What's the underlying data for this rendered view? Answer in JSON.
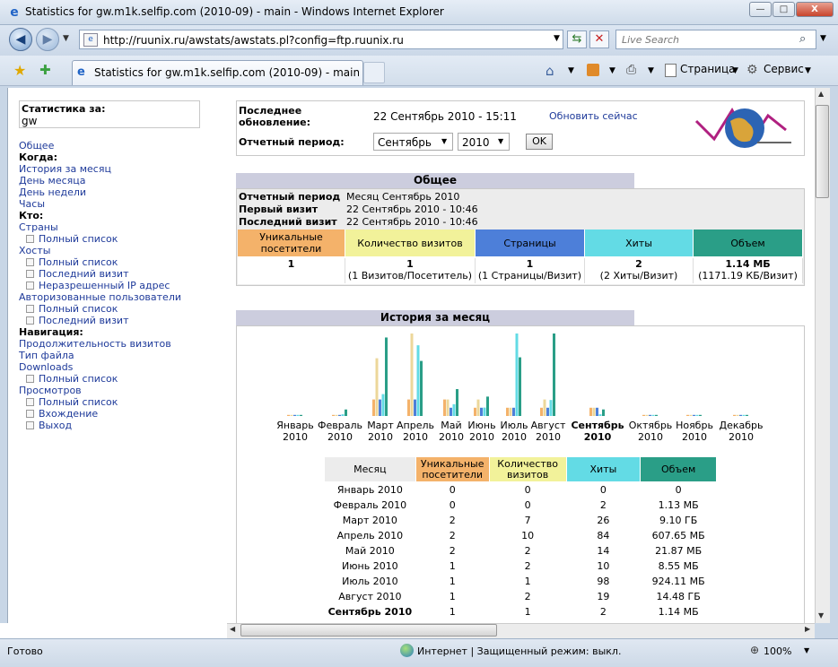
{
  "window": {
    "title": "Statistics for gw.m1k.selfip.com (2010-09) - main - Windows Internet Explorer",
    "minimize": "—",
    "maximize": "□",
    "close": "X"
  },
  "address": {
    "url": "http://ruunix.ru/awstats/awstats.pl?config=ftp.ruunix.ru",
    "search_placeholder": "Live Search"
  },
  "tab": {
    "label": "Statistics for gw.m1k.selfip.com (2010-09) - main"
  },
  "commandbar": {
    "page": "Страница",
    "tools": "Сервис"
  },
  "sidebar": {
    "stats_for_label": "Статистика за:",
    "site": "gw",
    "items": [
      {
        "type": "link",
        "text": "Общее"
      },
      {
        "type": "head",
        "text": "Когда:"
      },
      {
        "type": "link",
        "text": "История за месяц"
      },
      {
        "type": "link",
        "text": "День месяца"
      },
      {
        "type": "link",
        "text": "День недели"
      },
      {
        "type": "link",
        "text": "Часы"
      },
      {
        "type": "head",
        "text": "Кто:"
      },
      {
        "type": "link",
        "text": "Страны"
      },
      {
        "type": "sub",
        "text": "Полный список"
      },
      {
        "type": "link",
        "text": "Хосты"
      },
      {
        "type": "sub",
        "text": "Полный список"
      },
      {
        "type": "sub",
        "text": "Последний визит"
      },
      {
        "type": "sub",
        "text": "Неразрешенный IP адрес"
      },
      {
        "type": "link",
        "text": "Авторизованные пользователи"
      },
      {
        "type": "sub",
        "text": "Полный список"
      },
      {
        "type": "sub",
        "text": "Последний визит"
      },
      {
        "type": "head",
        "text": "Навигация:"
      },
      {
        "type": "link",
        "text": "Продолжительность визитов"
      },
      {
        "type": "link",
        "text": "Тип файла"
      },
      {
        "type": "link",
        "text": "Downloads"
      },
      {
        "type": "sub",
        "text": "Полный список"
      },
      {
        "type": "link",
        "text": "Просмотров"
      },
      {
        "type": "sub",
        "text": "Полный список"
      },
      {
        "type": "sub",
        "text": "Вхождение"
      },
      {
        "type": "sub",
        "text": "Выход"
      }
    ]
  },
  "topbox": {
    "last_update_label_1": "Последнее",
    "last_update_label_2": "обновление:",
    "last_update_value": "22 Сентябрь 2010 - 15:11",
    "update_now": "Обновить сейчас",
    "period_label": "Отчетный период:",
    "month_selected": "Сентябрь",
    "year_selected": "2010",
    "ok_button": "OK"
  },
  "summary": {
    "title": "Общее",
    "period_label": "Отчетный период",
    "period_value": "Месяц Сентябрь 2010",
    "first_visit_label": "Первый визит",
    "first_visit_value": "22 Сентябрь 2010 - 10:46",
    "last_visit_label": "Последний визит",
    "last_visit_value": "22 Сентябрь 2010 - 10:46",
    "headers": [
      "Уникальные посетители",
      "Количество визитов",
      "Страницы",
      "Хиты",
      "Объем"
    ],
    "values": [
      "1",
      "1",
      "1",
      "2",
      "1.14 МБ"
    ],
    "subvalues": [
      "",
      "(1 Визитов/Посетитель)",
      "(1 Страницы/Визит)",
      "(2 Хиты/Визит)",
      "(1171.19 КБ/Визит)"
    ]
  },
  "history": {
    "title": "История за месяц",
    "table_headers": [
      "Месяц",
      "Уникальные посетители",
      "Количество визитов",
      "Хиты",
      "Объем"
    ],
    "rows": [
      [
        "Январь 2010",
        "0",
        "0",
        "0",
        "0"
      ],
      [
        "Февраль 2010",
        "0",
        "0",
        "2",
        "1.13 МБ"
      ],
      [
        "Март 2010",
        "2",
        "7",
        "26",
        "9.10 ГБ"
      ],
      [
        "Апрель 2010",
        "2",
        "10",
        "84",
        "607.65 МБ"
      ],
      [
        "Май 2010",
        "2",
        "2",
        "14",
        "21.87 МБ"
      ],
      [
        "Июнь 2010",
        "1",
        "2",
        "10",
        "8.55 МБ"
      ],
      [
        "Июль 2010",
        "1",
        "1",
        "98",
        "924.11 МБ"
      ],
      [
        "Август 2010",
        "1",
        "2",
        "19",
        "14.48 ГБ"
      ],
      [
        "Сентябрь 2010",
        "1",
        "1",
        "2",
        "1.14 МБ"
      ]
    ]
  },
  "chart_data": {
    "type": "bar",
    "categories": [
      "Январь 2010",
      "Февраль 2010",
      "Март 2010",
      "Апрель 2010",
      "Май 2010",
      "Июнь 2010",
      "Июль 2010",
      "Август 2010",
      "Сентябрь 2010",
      "Октябрь 2010",
      "Ноябрь 2010",
      "Декабрь 2010"
    ],
    "month_labels": [
      "Январь",
      "Февраль",
      "Март",
      "Апрель",
      "Май",
      "Июнь",
      "Июль",
      "Август",
      "Сентябрь",
      "Октябрь",
      "Ноябрь",
      "Декабрь"
    ],
    "year_label": "2010",
    "current_index": 8,
    "series": [
      {
        "name": "Уникальные посетители",
        "color": "#f4b26a",
        "values": [
          0,
          0,
          2,
          2,
          2,
          1,
          1,
          1,
          1,
          0,
          0,
          0
        ]
      },
      {
        "name": "Количество визитов",
        "color": "#ecd79a",
        "values": [
          0,
          0,
          7,
          10,
          2,
          2,
          1,
          2,
          1,
          0,
          0,
          0
        ]
      },
      {
        "name": "Страницы",
        "color": "#4d7fd9",
        "values": [
          0,
          0,
          2,
          2,
          1,
          1,
          1,
          1,
          1,
          0,
          0,
          0
        ]
      },
      {
        "name": "Хиты",
        "color": "#63dbe5",
        "values": [
          0,
          2,
          26,
          84,
          14,
          10,
          98,
          19,
          2,
          0,
          0,
          0
        ]
      },
      {
        "name": "Объем (МБ)",
        "color": "#2a9e87",
        "values": [
          0,
          1.13,
          9318,
          607.65,
          21.87,
          8.55,
          924.11,
          14827,
          1.14,
          0,
          0,
          0
        ]
      }
    ]
  },
  "statusbar": {
    "ready": "Готово",
    "zone": "Интернет | Защищенный режим: выкл.",
    "zoom": "100%"
  },
  "colors": {
    "visitors": "#f4b26a",
    "visits": "#f2f29a",
    "pages": "#4d7fd9",
    "hits": "#63dbe5",
    "bandwidth": "#2a9e87",
    "section_header": "#cccdde"
  }
}
